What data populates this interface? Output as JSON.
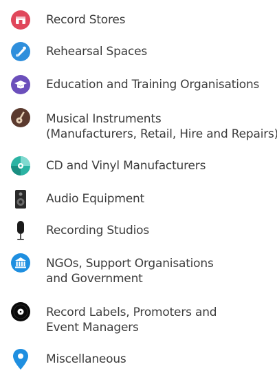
{
  "legend": {
    "items": [
      {
        "key": "record-stores",
        "icon": "record-store-icon",
        "color": "#e0475b",
        "lines": [
          "Record Stores"
        ]
      },
      {
        "key": "rehearsal-spaces",
        "icon": "guitar-pick-icon",
        "color": "#2f8fdc",
        "lines": [
          "Rehearsal Spaces"
        ]
      },
      {
        "key": "education",
        "icon": "graduation-cap-icon",
        "color": "#6b4fbb",
        "lines": [
          "Education and Training Organisations"
        ]
      },
      {
        "key": "instruments",
        "icon": "guitar-icon",
        "color": "#5b3a2e",
        "lines": [
          "Musical Instruments",
          "(Manufacturers, Retail, Hire and Repairs)"
        ]
      },
      {
        "key": "cd-vinyl",
        "icon": "cd-disc-icon",
        "color": "#2bb3a3",
        "lines": [
          "CD and Vinyl Manufacturers"
        ]
      },
      {
        "key": "audio-equipment",
        "icon": "speaker-icon",
        "color": "#2a2a2a",
        "lines": [
          "Audio Equipment"
        ]
      },
      {
        "key": "recording-studios",
        "icon": "microphone-icon",
        "color": "#1a1a1a",
        "lines": [
          "Recording Studios"
        ]
      },
      {
        "key": "ngos",
        "icon": "government-building-icon",
        "color": "#1f8fe0",
        "lines": [
          "NGOs, Support Organisations",
          "and Government"
        ]
      },
      {
        "key": "record-labels",
        "icon": "vinyl-record-icon",
        "color": "#0a0a0a",
        "lines": [
          "Record Labels, Promoters and",
          "Event Managers"
        ]
      },
      {
        "key": "miscellaneous",
        "icon": "map-pin-icon",
        "color": "#1f8fe0",
        "lines": [
          "Miscellaneous"
        ]
      }
    ]
  }
}
